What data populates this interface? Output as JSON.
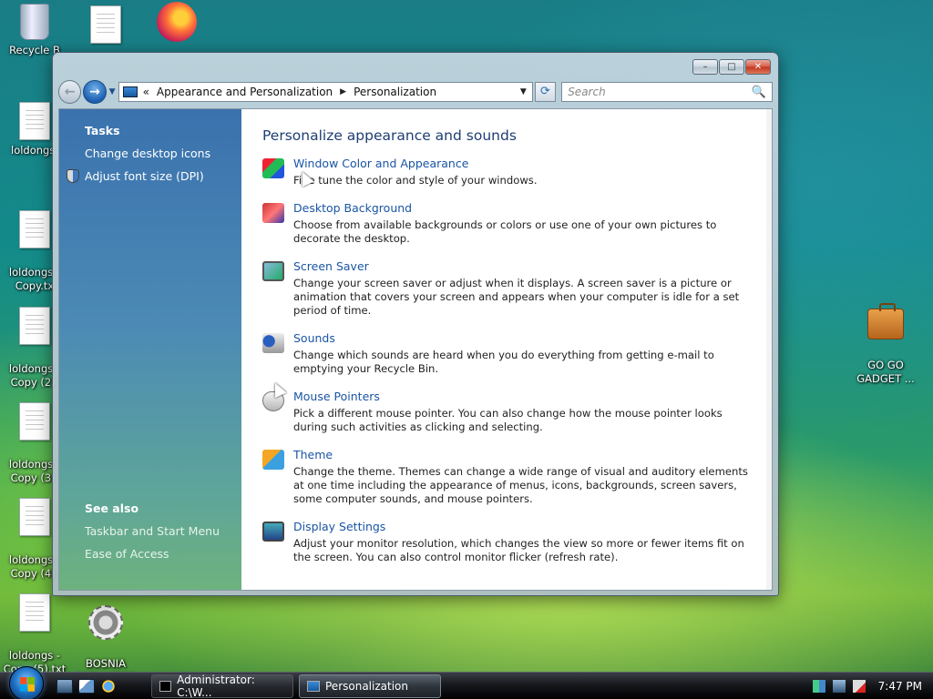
{
  "desktop": {
    "icons_left": [
      {
        "label": "Recycle B",
        "kind": "recycle-bin"
      },
      {
        "label": "loldongs.",
        "kind": "text-file"
      },
      {
        "label": "loldongs -\nCopy.tx",
        "kind": "text-file"
      },
      {
        "label": "loldongs -\nCopy (2).",
        "kind": "text-file"
      },
      {
        "label": "loldongs -\nCopy (3).",
        "kind": "text-file"
      },
      {
        "label": "loldongs -\nCopy (4).",
        "kind": "text-file"
      },
      {
        "label": "loldongs -\nCopy (5).txt",
        "kind": "text-file"
      }
    ],
    "icon_top_doc": "text-file",
    "icon_firefox": "firefox-shortcut",
    "icon_bosnia": {
      "label": "BOSNIA\nSIMULATOR"
    },
    "icon_gadget": {
      "label": "GO GO\nGADGET ..."
    }
  },
  "window": {
    "controls": {
      "minimize": "–",
      "maximize": "□",
      "close": "✕"
    },
    "nav": {
      "back": "←",
      "forward": "→",
      "dropdown": "▼"
    },
    "address": {
      "prefix": "«",
      "crumbs": [
        "Appearance and Personalization",
        "Personalization"
      ],
      "separator": "▶",
      "dropdown": "▼",
      "refresh": "⟳"
    },
    "search": {
      "placeholder": "Search",
      "icon": "🔍"
    },
    "tasks": {
      "heading": "Tasks",
      "links": [
        "Change desktop icons",
        "Adjust font size (DPI)"
      ]
    },
    "see_also": {
      "heading": "See also",
      "links": [
        "Taskbar and Start Menu",
        "Ease of Access"
      ]
    },
    "main": {
      "title": "Personalize appearance and sounds",
      "items": [
        {
          "title": "Window Color and Appearance",
          "desc": "Fine tune the color and style of your windows."
        },
        {
          "title": "Desktop Background",
          "desc": "Choose from available backgrounds or colors or use one of your own pictures to decorate the desktop."
        },
        {
          "title": "Screen Saver",
          "desc": "Change your screen saver or adjust when it displays. A screen saver is a picture or animation that covers your screen and appears when your computer is idle for a set period of time."
        },
        {
          "title": "Sounds",
          "desc": "Change which sounds are heard when you do everything from getting e-mail to emptying your Recycle Bin."
        },
        {
          "title": "Mouse Pointers",
          "desc": "Pick a different mouse pointer. You can also change how the mouse pointer looks during such activities as clicking and selecting."
        },
        {
          "title": "Theme",
          "desc": "Change the theme. Themes can change a wide range of visual and auditory elements at one time including the appearance of menus, icons, backgrounds, screen savers, some computer sounds, and mouse pointers."
        },
        {
          "title": "Display Settings",
          "desc": "Adjust your monitor resolution, which changes the view so more or fewer items fit on the screen. You can also control monitor flicker (refresh rate)."
        }
      ]
    }
  },
  "taskbar": {
    "buttons": [
      "Administrator: C:\\W...",
      "Personalization"
    ],
    "clock": "7:47 PM"
  }
}
